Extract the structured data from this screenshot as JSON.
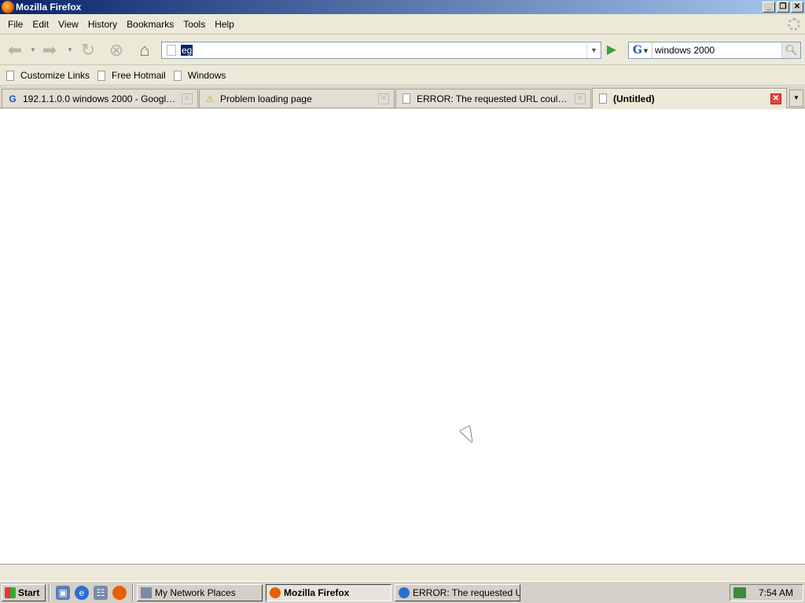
{
  "window": {
    "title": "Mozilla Firefox",
    "controls": [
      "_",
      "❐",
      "✕"
    ]
  },
  "menu": [
    "File",
    "Edit",
    "View",
    "History",
    "Bookmarks",
    "Tools",
    "Help"
  ],
  "nav": {
    "back_icon": "back-arrow-icon",
    "url_value": "eg",
    "search_engine": "G",
    "search_value": "windows 2000"
  },
  "bookmarks": [
    "Customize Links",
    "Free Hotmail",
    "Windows"
  ],
  "tabs": [
    {
      "label": "192.1.1.0.0 windows 2000 - Google S...",
      "icon": "google-icon"
    },
    {
      "label": "Problem loading page",
      "icon": "warning-icon"
    },
    {
      "label": "ERROR: The requested URL could not ...",
      "icon": "page-icon"
    },
    {
      "label": "(Untitled)",
      "icon": "page-icon",
      "active": true
    }
  ],
  "taskbar": {
    "start_label": "Start",
    "buttons": [
      {
        "label": "My Network Places"
      },
      {
        "label": "Mozilla Firefox",
        "pressed": true
      },
      {
        "label": "ERROR: The requested U..."
      }
    ],
    "clock": "7:54 AM"
  },
  "colors": {
    "titlebar_start": "#0a246a",
    "titlebar_end": "#a6caf0",
    "selection": "#0a246a",
    "go_green": "#3aa23a",
    "close_active_tab": "#e8453c"
  }
}
